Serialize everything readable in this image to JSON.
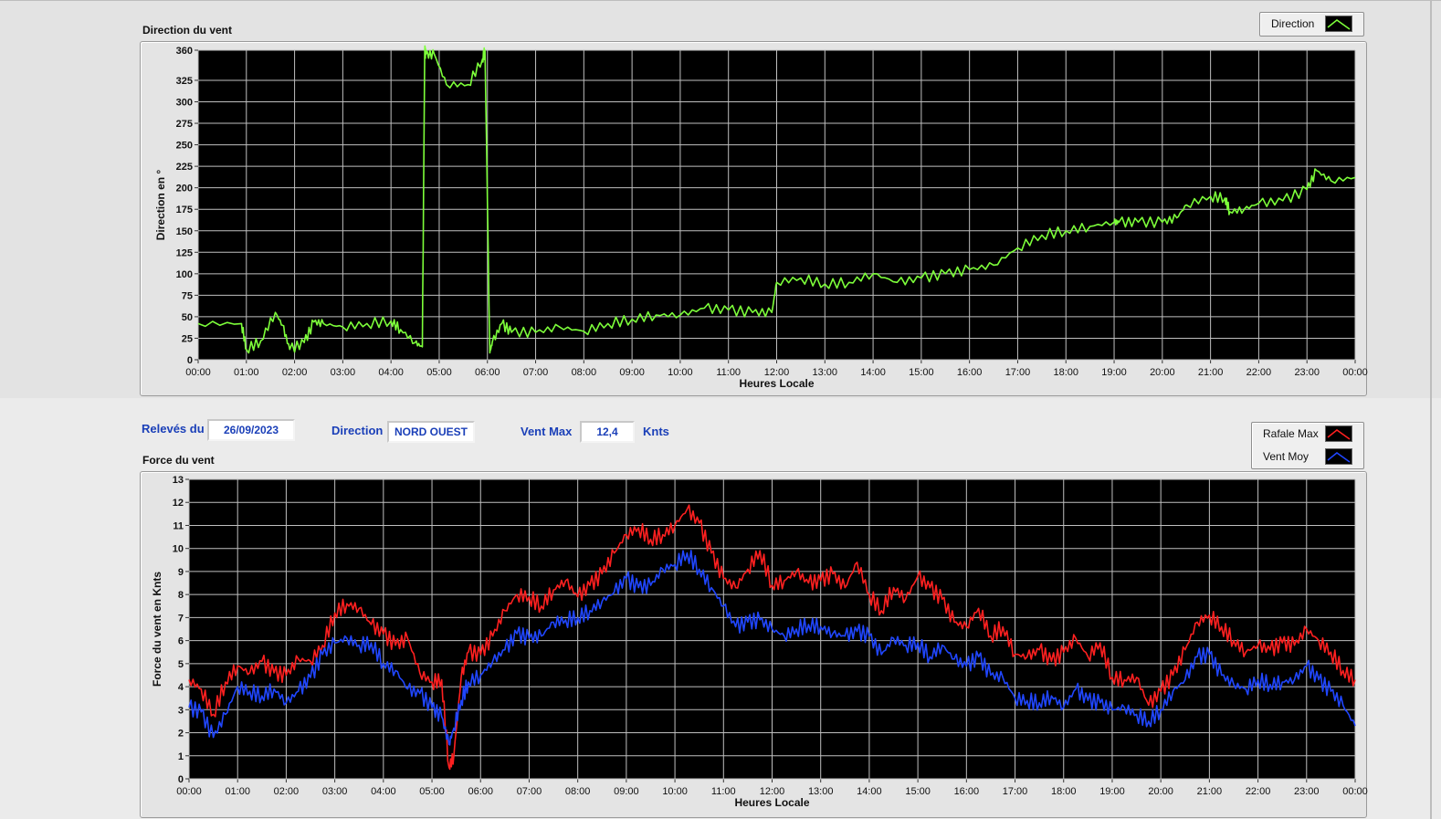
{
  "colors": {
    "direction": "#7dff3a",
    "gust": "#ff2020",
    "mean": "#2046ff",
    "label": "#1a3fb8"
  },
  "controls": {
    "date_label": "Relevés du",
    "date_value": "26/09/2023",
    "direction_label": "Direction",
    "direction_value": "NORD OUEST",
    "max_label": "Vent Max",
    "max_value": "12,4",
    "max_unit": "Knts"
  },
  "legend_top": {
    "items": [
      {
        "label": "Direction",
        "color": "#7dff3a"
      }
    ]
  },
  "legend_bottom": {
    "items": [
      {
        "label": "Rafale Max",
        "color": "#ff2020"
      },
      {
        "label": "Vent Moy",
        "color": "#2046ff"
      }
    ]
  },
  "chart_data": [
    {
      "type": "line",
      "title": "Direction du vent",
      "xlabel": "Heures Locale",
      "ylabel": "Direction en °",
      "xlim": [
        0,
        24
      ],
      "ylim": [
        0,
        360
      ],
      "grid": true,
      "legend": "top-right, outside plot",
      "x_ticks": [
        "00:00",
        "01:00",
        "02:00",
        "03:00",
        "04:00",
        "05:00",
        "06:00",
        "07:00",
        "08:00",
        "09:00",
        "10:00",
        "11:00",
        "12:00",
        "13:00",
        "14:00",
        "15:00",
        "16:00",
        "17:00",
        "18:00",
        "19:00",
        "20:00",
        "21:00",
        "22:00",
        "23:00",
        "00:00"
      ],
      "y_ticks": [
        0,
        25,
        50,
        75,
        100,
        125,
        150,
        175,
        200,
        225,
        250,
        275,
        300,
        325,
        360
      ],
      "series": [
        {
          "name": "Direction",
          "color": "#7dff3a",
          "x": [
            0,
            0.9,
            1.0,
            1.3,
            1.6,
            1.75,
            1.9,
            2.2,
            2.4,
            2.6,
            3.0,
            3.5,
            4.0,
            4.2,
            4.5,
            4.65,
            4.7,
            4.72,
            4.9,
            5.15,
            5.6,
            5.9,
            5.95,
            6.05,
            6.1,
            6.3,
            6.5,
            7.0,
            7.5,
            8.0,
            8.5,
            9.0,
            9.5,
            10.0,
            10.5,
            11.0,
            11.5,
            11.9,
            12.0,
            12.5,
            13.0,
            13.5,
            14.0,
            14.5,
            15.0,
            15.5,
            16.0,
            16.5,
            17.0,
            17.5,
            18.0,
            18.5,
            19.0,
            19.1,
            19.5,
            20.0,
            20.3,
            20.5,
            21.0,
            21.3,
            21.4,
            21.7,
            22.0,
            22.5,
            23.0,
            23.2,
            23.5,
            24.0
          ],
          "y": [
            42,
            42,
            12,
            22,
            55,
            40,
            12,
            20,
            44,
            42,
            38,
            42,
            45,
            35,
            20,
            15,
            360,
            355,
            355,
            320,
            320,
            350,
            360,
            8,
            20,
            42,
            32,
            32,
            38,
            33,
            42,
            47,
            52,
            52,
            60,
            58,
            55,
            55,
            90,
            95,
            88,
            90,
            100,
            90,
            95,
            100,
            105,
            110,
            130,
            145,
            150,
            155,
            160,
            160,
            160,
            160,
            165,
            180,
            190,
            188,
            172,
            175,
            182,
            185,
            198,
            220,
            208,
            212
          ]
        }
      ]
    },
    {
      "type": "line",
      "title": "Force du vent",
      "xlabel": "Heures Locale",
      "ylabel": "Force du vent en Knts",
      "xlim": [
        0,
        24
      ],
      "ylim": [
        0,
        13
      ],
      "grid": true,
      "legend": "top-right, outside plot",
      "x_ticks": [
        "00:00",
        "01:00",
        "02:00",
        "03:00",
        "04:00",
        "05:00",
        "06:00",
        "07:00",
        "08:00",
        "09:00",
        "10:00",
        "11:00",
        "12:00",
        "13:00",
        "14:00",
        "15:00",
        "16:00",
        "17:00",
        "18:00",
        "19:00",
        "20:00",
        "21:00",
        "22:00",
        "23:00",
        "00:00"
      ],
      "y_ticks": [
        0,
        1,
        2,
        3,
        4,
        5,
        6,
        7,
        8,
        9,
        10,
        11,
        12,
        13
      ],
      "series": [
        {
          "name": "Rafale Max",
          "color": "#ff2020",
          "x": [
            0,
            0.25,
            0.5,
            0.75,
            1,
            1.25,
            1.5,
            1.75,
            2,
            2.25,
            2.5,
            2.75,
            3,
            3.25,
            3.5,
            3.75,
            4,
            4.25,
            4.5,
            4.75,
            5,
            5.2,
            5.35,
            5.45,
            5.6,
            5.75,
            6,
            6.25,
            6.5,
            6.75,
            7,
            7.25,
            7.5,
            7.75,
            8,
            8.25,
            8.5,
            8.75,
            9,
            9.25,
            9.5,
            9.75,
            10,
            10.25,
            10.5,
            10.75,
            11,
            11.25,
            11.5,
            11.75,
            12,
            12.25,
            12.5,
            12.75,
            13,
            13.25,
            13.5,
            13.75,
            14,
            14.25,
            14.5,
            14.75,
            15,
            15.25,
            15.5,
            15.75,
            16,
            16.25,
            16.5,
            16.75,
            17,
            17.25,
            17.5,
            17.75,
            18,
            18.25,
            18.5,
            18.75,
            19,
            19.25,
            19.5,
            19.75,
            20,
            20.25,
            20.5,
            20.75,
            21,
            21.25,
            21.5,
            21.75,
            22,
            22.25,
            22.5,
            22.75,
            23,
            23.25,
            23.5,
            23.75,
            24
          ],
          "y": [
            4.3,
            3.9,
            2.8,
            4.2,
            4.9,
            4.6,
            5.1,
            4.6,
            4.5,
            5.2,
            5.1,
            5.8,
            7.2,
            7.6,
            7.4,
            6.7,
            6.3,
            5.8,
            6.1,
            4.6,
            4.2,
            4.3,
            0.5,
            1.0,
            4.4,
            5.5,
            5.4,
            6.2,
            7.3,
            8.0,
            7.9,
            7.5,
            8.2,
            8.6,
            7.9,
            8.4,
            8.9,
            9.8,
            10.6,
            10.9,
            10.4,
            10.6,
            11.0,
            11.7,
            11.1,
            9.8,
            8.7,
            8.3,
            9.1,
            9.9,
            8.4,
            8.6,
            9.0,
            8.5,
            8.6,
            8.9,
            8.3,
            9.4,
            8.0,
            7.3,
            8.3,
            7.8,
            8.8,
            8.3,
            7.8,
            6.8,
            6.6,
            7.4,
            6.2,
            6.6,
            5.4,
            5.3,
            5.6,
            5.1,
            5.5,
            6.1,
            5.3,
            5.9,
            4.4,
            4.3,
            4.4,
            3.2,
            3.8,
            4.5,
            5.6,
            6.8,
            7.1,
            6.6,
            6.0,
            5.5,
            5.8,
            5.6,
            5.9,
            5.8,
            6.5,
            6.0,
            5.5,
            4.7,
            4.3
          ]
        },
        {
          "name": "Vent Moy",
          "color": "#2046ff",
          "x": [
            0,
            0.25,
            0.5,
            0.75,
            1,
            1.25,
            1.5,
            1.75,
            2,
            2.25,
            2.5,
            2.75,
            3,
            3.25,
            3.5,
            3.75,
            4,
            4.25,
            4.5,
            4.75,
            5,
            5.2,
            5.35,
            5.45,
            5.6,
            5.75,
            6,
            6.25,
            6.5,
            6.75,
            7,
            7.25,
            7.5,
            7.75,
            8,
            8.25,
            8.5,
            8.75,
            9,
            9.25,
            9.5,
            9.75,
            10,
            10.25,
            10.5,
            10.75,
            11,
            11.25,
            11.5,
            11.75,
            12,
            12.25,
            12.5,
            12.75,
            13,
            13.25,
            13.5,
            13.75,
            14,
            14.25,
            14.5,
            14.75,
            15,
            15.25,
            15.5,
            15.75,
            16,
            16.25,
            16.5,
            16.75,
            17,
            17.25,
            17.5,
            17.75,
            18,
            18.25,
            18.5,
            18.75,
            19,
            19.25,
            19.5,
            19.75,
            20,
            20.25,
            20.5,
            20.75,
            21,
            21.25,
            21.5,
            21.75,
            22,
            22.25,
            22.5,
            22.75,
            23,
            23.25,
            23.5,
            23.75,
            24
          ],
          "y": [
            3.1,
            2.9,
            1.8,
            2.8,
            4.0,
            3.8,
            3.6,
            3.9,
            3.3,
            3.8,
            4.4,
            5.4,
            5.9,
            6.1,
            5.8,
            5.9,
            5.0,
            4.7,
            3.9,
            3.7,
            3.1,
            2.7,
            1.5,
            2.2,
            3.4,
            4.2,
            4.5,
            5.1,
            5.6,
            6.3,
            6.1,
            6.2,
            6.8,
            6.9,
            7.0,
            7.3,
            7.7,
            8.1,
            8.7,
            8.3,
            8.4,
            9.1,
            9.3,
            9.8,
            9.1,
            8.3,
            7.5,
            6.6,
            6.8,
            6.9,
            6.5,
            6.2,
            6.5,
            6.7,
            6.6,
            6.3,
            6.2,
            6.4,
            6.2,
            5.4,
            6.1,
            5.8,
            5.9,
            5.3,
            5.8,
            5.2,
            4.9,
            5.3,
            4.5,
            4.4,
            3.5,
            3.4,
            3.3,
            3.6,
            3.1,
            3.9,
            3.4,
            3.3,
            3.0,
            3.1,
            2.8,
            2.5,
            3.0,
            3.8,
            4.3,
            5.3,
            5.4,
            4.5,
            4.1,
            3.9,
            4.3,
            4.1,
            4.2,
            4.3,
            4.9,
            4.3,
            3.8,
            3.2,
            2.3
          ]
        }
      ]
    }
  ]
}
